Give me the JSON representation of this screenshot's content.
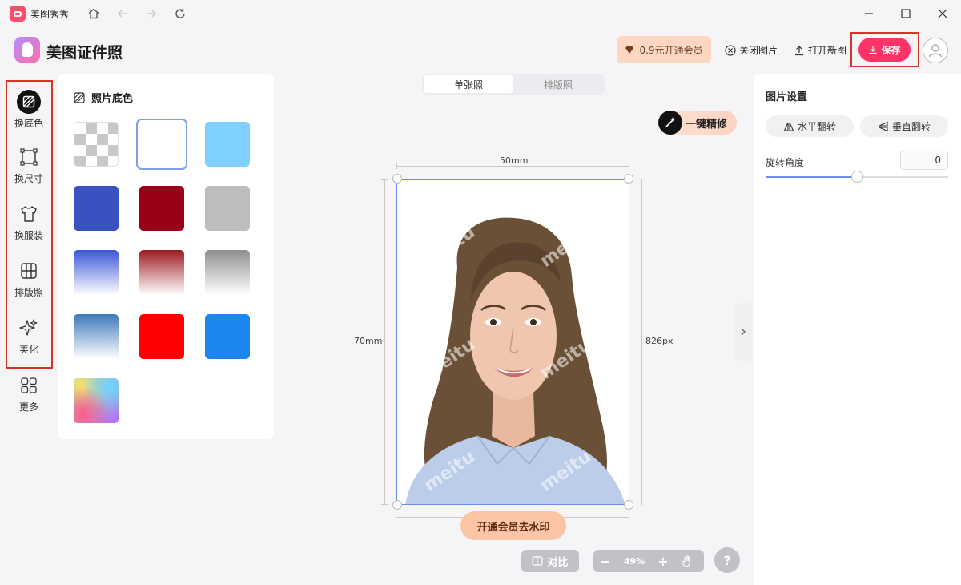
{
  "titlebar": {
    "app_name": "美图秀秀"
  },
  "header": {
    "product_name": "美图证件照",
    "vip_label": "0.9元开通会员",
    "close_image_label": "关闭图片",
    "open_new_label": "打开新图",
    "save_label": "保存"
  },
  "rail": {
    "items": [
      {
        "label": "换底色",
        "icon": "background-color-icon"
      },
      {
        "label": "换尺寸",
        "icon": "resize-icon"
      },
      {
        "label": "换服装",
        "icon": "clothing-icon"
      },
      {
        "label": "排版照",
        "icon": "layout-grid-icon"
      },
      {
        "label": "美化",
        "icon": "sparkle-icon"
      },
      {
        "label": "更多",
        "icon": "more-apps-icon"
      }
    ]
  },
  "color_panel": {
    "title": "照片底色",
    "swatches": [
      {
        "name": "transparent"
      },
      {
        "name": "white",
        "color": "#ffffff"
      },
      {
        "name": "light-blue",
        "color": "#7fcfff"
      },
      {
        "name": "blue",
        "color": "#3a52c0"
      },
      {
        "name": "dark-red",
        "color": "#980017"
      },
      {
        "name": "gray",
        "color": "#bfbcbc"
      },
      {
        "name": "blue-gradient",
        "color": "#3b56d8"
      },
      {
        "name": "red-gradient",
        "color": "#9c1a20"
      },
      {
        "name": "gray-gradient",
        "color": "#8f8f8f"
      },
      {
        "name": "steel-blue-gradient",
        "color": "#3f79ba"
      },
      {
        "name": "red",
        "color": "#ff0000"
      },
      {
        "name": "bright-blue",
        "color": "#1e86f0"
      },
      {
        "name": "rainbow-gradient"
      }
    ],
    "selected": "white"
  },
  "canvas": {
    "tabs": [
      {
        "label": "单张照"
      },
      {
        "label": "排版照"
      }
    ],
    "retouch_label": "一键精修",
    "width_label": "50mm",
    "height_label": "70mm",
    "pixel_label": "826px",
    "watermark_button": "开通会员去水印",
    "compare_label": "对比",
    "zoom_value": "49%",
    "help_label": "?"
  },
  "settings": {
    "title": "图片设置",
    "flip_h_label": "水平翻转",
    "flip_v_label": "垂直翻转",
    "rotation_label": "旋转角度",
    "rotation_value": "0",
    "rotation_slider_fraction": 0.5
  }
}
